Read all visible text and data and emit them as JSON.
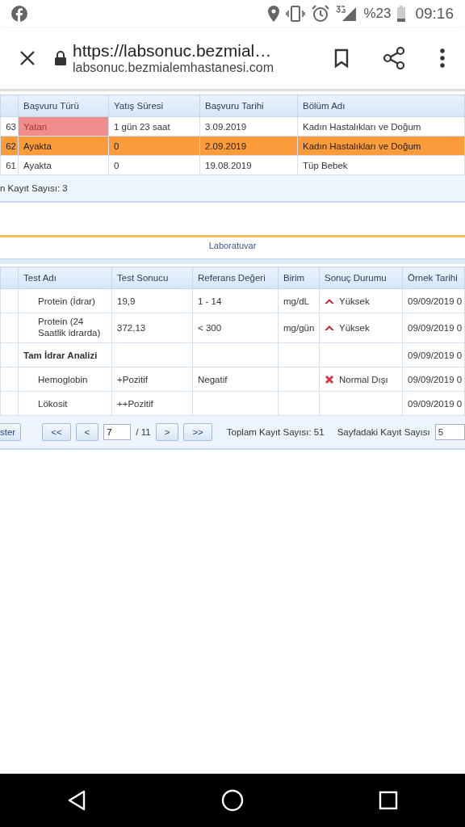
{
  "status_bar": {
    "battery": "%23",
    "time": "09:16"
  },
  "browser": {
    "title": "https://labsonuc.bezmial…",
    "url": "labsonuc.bezmialemhastanesi.com"
  },
  "visits": {
    "columns": [
      "Başvuru Türü",
      "Yatış Süresi",
      "Başvuru Tarihi",
      "Bölüm Adı"
    ],
    "rows": [
      {
        "column_1": "63",
        "type": "Yatan",
        "inpatient": true,
        "duration": "1 gün 23 saat",
        "date": "3.09.2019",
        "department": "Kadın Hastalıkları ve Doğum",
        "selected": false
      },
      {
        "column_1": "62",
        "type": "Ayakta",
        "inpatient": false,
        "duration": "0",
        "date": "2.09.2019",
        "department": "Kadın Hastalıkları ve Doğum",
        "selected": true
      },
      {
        "column_1": "61",
        "type": "Ayakta",
        "inpatient": false,
        "duration": "0",
        "date": "19.08.2019",
        "department": "Tüp Bebek",
        "selected": false
      }
    ],
    "footer": "n Kayıt Sayısı: 3"
  },
  "section_title": "Laboratuvar",
  "lab": {
    "columns": [
      "Test Adı",
      "Test Sonucu",
      "Referans Değeri",
      "Birim",
      "Sonuç Durumu",
      "Örnek Tarihi"
    ],
    "rows": [
      {
        "kind": "test",
        "name": "Protein (İdrar)",
        "result": "19,9",
        "reference": "1 - 14",
        "unit": "mg/dL",
        "status": {
          "kind": "high",
          "label": "Yüksek"
        },
        "date": "09/09/2019 0"
      },
      {
        "kind": "test",
        "name": "Protein (24 Saatlik idrarda)",
        "result": "372,13",
        "reference": "< 300",
        "unit": "mg/gün",
        "status": {
          "kind": "high",
          "label": "Yüksek"
        },
        "date": "09/09/2019 0"
      },
      {
        "kind": "group",
        "name": "Tam İdrar Analizi",
        "date": "09/09/2019 0",
        "children": [
          {
            "kind": "test",
            "name": "Hemoglobin",
            "result": "+Pozitif",
            "reference": "Negatif",
            "status": {
              "kind": "abnormal",
              "label": "Normal Dışı"
            },
            "date": "09/09/2019 0"
          },
          {
            "kind": "test",
            "name": "Lökosit",
            "result": "++Pozitif",
            "date": "09/09/2019 0"
          }
        ]
      }
    ]
  },
  "pager": {
    "left_button": "ster",
    "first": "<<",
    "prev": "<",
    "page": "7",
    "total": "/ 11",
    "next": ">",
    "last": ">>",
    "total_records": "Toplam Kayıt Sayısı: 51",
    "page_size_label": "Sayfadaki Kayıt Sayısı",
    "page_size": "5"
  }
}
